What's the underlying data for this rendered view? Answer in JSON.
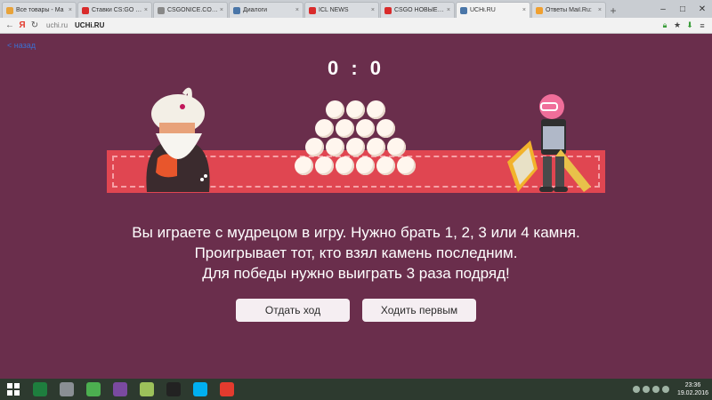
{
  "browser": {
    "tabs": [
      {
        "label": "Все товары - Ма",
        "fav": "#e8a33a"
      },
      {
        "label": "Ставки CS:GO | К",
        "fav": "#d92b2b"
      },
      {
        "label": "CSGONICE.COM | ",
        "fav": "#888888"
      },
      {
        "label": "Диалоги",
        "fav": "#4a76a8"
      },
      {
        "label": "ICL NEWS",
        "fav": "#d92b2b"
      },
      {
        "label": "CSGO НОВЫЕ КА",
        "fav": "#d92b2b"
      },
      {
        "label": "UCHi.RU",
        "fav": "#4a76a8",
        "active": true
      },
      {
        "label": "Ответы Mail.Ru: ",
        "fav": "#f0a030"
      }
    ],
    "new_tab": "+",
    "address_host": "uchi.ru",
    "address_title": "UCHi.RU"
  },
  "game": {
    "back_link": "< назад",
    "score": "0 : 0",
    "message_lines": [
      "Вы играете с мудрецом в игру. Нужно брать 1, 2, 3 или 4 камня.",
      "Проигрывает тот, кто взял камень последним.",
      "Для победы нужно выиграть 3 раза подряд!"
    ],
    "buttons": {
      "pass_turn": "Отдать ход",
      "go_first": "Ходить первым"
    },
    "stones_rows": [
      3,
      4,
      5,
      6
    ],
    "colors": {
      "background": "#6a2e4c",
      "rug": "#e04651",
      "stone": "#fff6ee"
    }
  },
  "taskbar": {
    "time": "23:36",
    "date": "19.02.2016",
    "icons": [
      {
        "name": "excel-icon",
        "color": "#1e7e3e"
      },
      {
        "name": "shield-icon",
        "color": "#8a8f94"
      },
      {
        "name": "utorrent-icon",
        "color": "#4caf50"
      },
      {
        "name": "winrar-icon",
        "color": "#7a4aa0"
      },
      {
        "name": "notes-icon",
        "color": "#9cc15a"
      },
      {
        "name": "steam-disc-icon",
        "color": "#222222"
      },
      {
        "name": "skype-icon",
        "color": "#00aff0"
      },
      {
        "name": "yandex-browser-icon",
        "color": "#e33b2e"
      }
    ]
  }
}
